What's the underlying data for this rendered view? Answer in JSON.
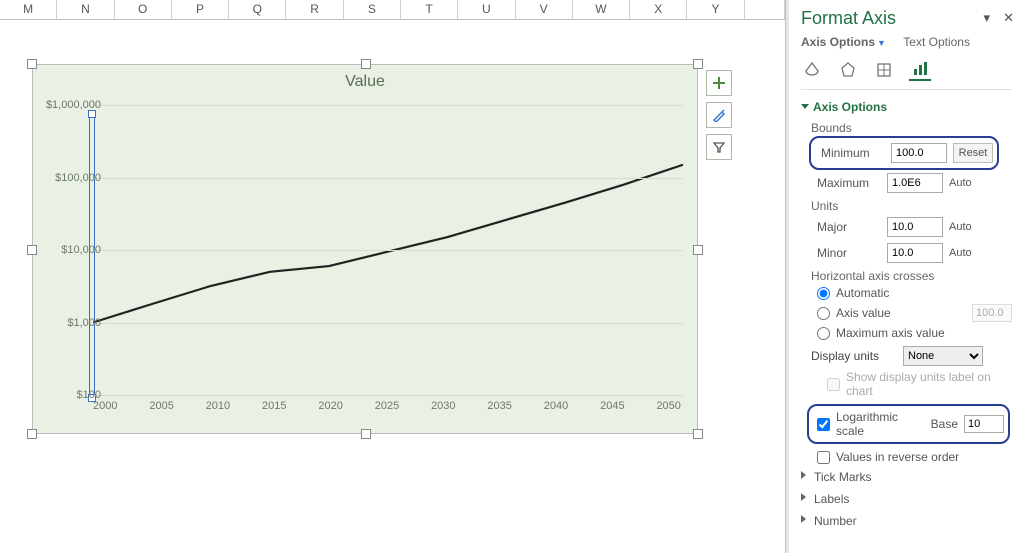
{
  "columns": [
    "M",
    "N",
    "O",
    "P",
    "Q",
    "R",
    "S",
    "T",
    "U",
    "V",
    "W",
    "X",
    "Y",
    ""
  ],
  "chart": {
    "title": "Value",
    "y_ticks": [
      "$1,000,000",
      "$100,000",
      "$10,000",
      "$1,000",
      "$100"
    ],
    "x_ticks": [
      "2000",
      "2005",
      "2010",
      "2015",
      "2020",
      "2025",
      "2030",
      "2035",
      "2040",
      "2045",
      "2050"
    ]
  },
  "pane": {
    "title": "Format Axis",
    "tab_axis_options": "Axis Options",
    "tab_text_options": "Text Options",
    "section_axis_options": "Axis Options",
    "bounds_label": "Bounds",
    "minimum_label": "Minimum",
    "minimum_value": "100.0",
    "minimum_aux": "Reset",
    "maximum_label": "Maximum",
    "maximum_value": "1.0E6",
    "maximum_aux": "Auto",
    "units_label": "Units",
    "major_label": "Major",
    "major_value": "10.0",
    "major_aux": "Auto",
    "minor_label": "Minor",
    "minor_value": "10.0",
    "minor_aux": "Auto",
    "hac_label": "Horizontal axis crosses",
    "hac_auto": "Automatic",
    "hac_axis_value": "Axis value",
    "hac_axis_value_num": "100.0",
    "hac_max": "Maximum axis value",
    "display_units_label": "Display units",
    "display_units_value": "None",
    "show_du_label": "Show display units label on chart",
    "log_scale_label": "Logarithmic scale",
    "base_label": "Base",
    "base_value": "10",
    "reverse_label": "Values in reverse order",
    "section_tickmarks": "Tick Marks",
    "section_labels": "Labels",
    "section_number": "Number"
  },
  "chart_data": {
    "type": "line",
    "title": "Value",
    "xlabel": "",
    "ylabel": "",
    "x": [
      2000,
      2005,
      2010,
      2015,
      2020,
      2025,
      2030,
      2035,
      2040,
      2045,
      2050
    ],
    "values": [
      1000,
      1800,
      3200,
      5000,
      6000,
      9500,
      15000,
      26000,
      45000,
      80000,
      150000
    ],
    "y_scale": "log",
    "ylim": [
      100,
      1000000
    ],
    "xlim": [
      2000,
      2050
    ]
  }
}
